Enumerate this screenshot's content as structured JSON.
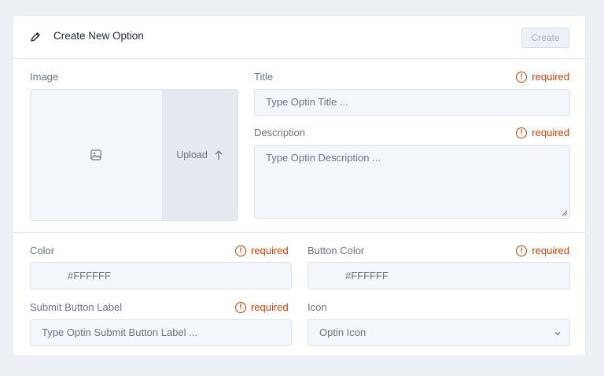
{
  "header": {
    "title": "Create New Option",
    "create_label": "Create"
  },
  "image": {
    "label": "Image",
    "upload_label": "Upload"
  },
  "title_field": {
    "label": "Title",
    "required": "required",
    "placeholder": "Type Optin Title ..."
  },
  "description_field": {
    "label": "Description",
    "required": "required",
    "placeholder": "Type Optin Description ..."
  },
  "color_field": {
    "label": "Color",
    "required": "required",
    "value": "#FFFFFF"
  },
  "button_color_field": {
    "label": "Button Color",
    "required": "required",
    "value": "#FFFFFF"
  },
  "submit_label_field": {
    "label": "Submit Button Label",
    "required": "required",
    "placeholder": "Type Optin Submit Button Label ..."
  },
  "icon_field": {
    "label": "Icon",
    "selected": "Optin Icon"
  },
  "colors": {
    "required": "#c2410c",
    "field_bg": "#f3f6fa",
    "page_bg": "#eceff4"
  }
}
